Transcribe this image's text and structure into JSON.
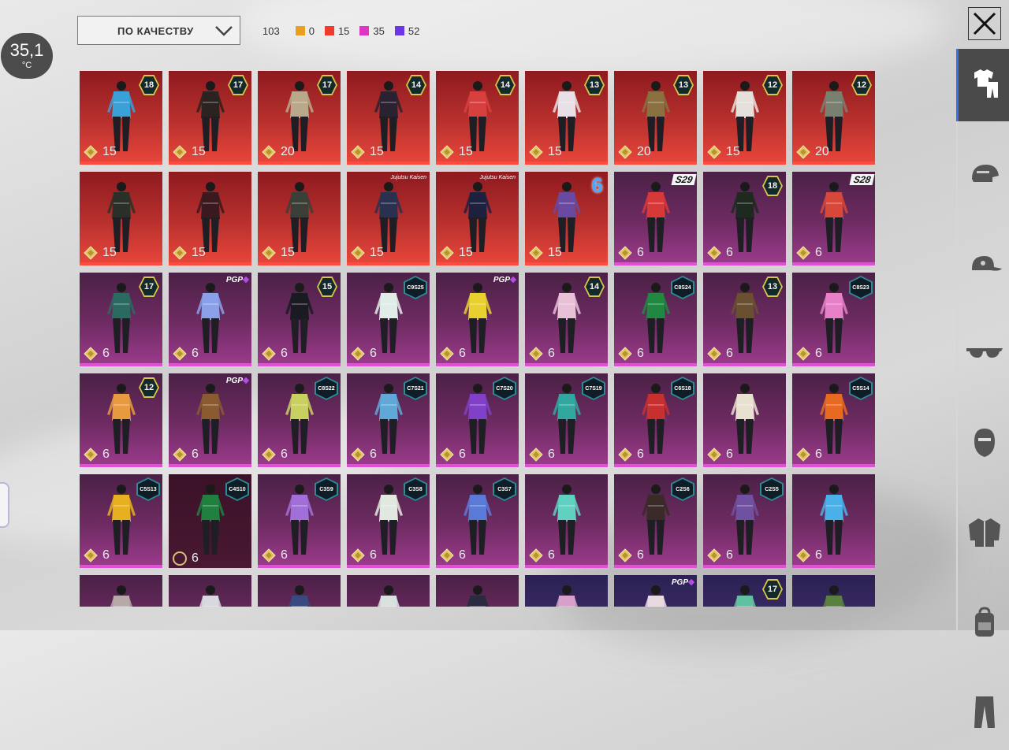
{
  "status": {
    "temperature": "35,1",
    "unit": "°C"
  },
  "sort": {
    "label": "ПО КАЧЕСТВУ"
  },
  "stats": {
    "total": "103",
    "items": [
      {
        "name": "gold",
        "value": "0",
        "color": "#e8a020"
      },
      {
        "name": "red",
        "value": "15",
        "color": "#f03a2e"
      },
      {
        "name": "pink",
        "value": "35",
        "color": "#e034c4"
      },
      {
        "name": "purple",
        "value": "52",
        "color": "#6a36e8"
      }
    ]
  },
  "categories": [
    {
      "id": "outfits",
      "icon": "shirt-pants-icon",
      "active": true
    },
    {
      "id": "helmets",
      "icon": "helmet-icon"
    },
    {
      "id": "hats",
      "icon": "cap-icon"
    },
    {
      "id": "glasses",
      "icon": "sunglasses-icon"
    },
    {
      "id": "masks",
      "icon": "mask-icon"
    },
    {
      "id": "jackets",
      "icon": "jacket-icon"
    },
    {
      "id": "backpacks",
      "icon": "backpack-icon"
    },
    {
      "id": "pants",
      "icon": "pants-icon"
    }
  ],
  "rows": [
    [
      {
        "tier": "red",
        "badge": "lvl",
        "badge_text": "18",
        "points": "15",
        "outfit": "#3aa0d8"
      },
      {
        "tier": "red",
        "badge": "lvl",
        "badge_text": "17",
        "points": "15",
        "outfit": "#2a2320"
      },
      {
        "tier": "red",
        "badge": "lvl",
        "badge_text": "17",
        "points": "20",
        "outfit": "#b9a98a"
      },
      {
        "tier": "red",
        "badge": "lvl",
        "badge_text": "14",
        "points": "15",
        "outfit": "#2a2230"
      },
      {
        "tier": "red",
        "badge": "lvl",
        "badge_text": "14",
        "points": "15",
        "outfit": "#d84040"
      },
      {
        "tier": "red",
        "badge": "lvl",
        "badge_text": "13",
        "points": "15",
        "outfit": "#e8e0e6"
      },
      {
        "tier": "red",
        "badge": "lvl",
        "badge_text": "13",
        "points": "20",
        "outfit": "#8a7040"
      },
      {
        "tier": "red",
        "badge": "lvl",
        "badge_text": "12",
        "points": "15",
        "outfit": "#e6e0dc"
      },
      {
        "tier": "red",
        "badge": "lvl",
        "badge_text": "12",
        "points": "20",
        "outfit": "#7a8070"
      }
    ],
    [
      {
        "tier": "red",
        "badge": "none",
        "badge_text": "",
        "points": "15",
        "outfit": "#2a3028"
      },
      {
        "tier": "red",
        "badge": "none",
        "badge_text": "",
        "points": "15",
        "outfit": "#3a1a1e"
      },
      {
        "tier": "red",
        "badge": "none",
        "badge_text": "",
        "points": "15",
        "outfit": "#3a4038"
      },
      {
        "tier": "red",
        "badge": "tag",
        "badge_text": "Jujutsu Kaisen",
        "points": "15",
        "outfit": "#2a3050"
      },
      {
        "tier": "red",
        "badge": "tag",
        "badge_text": "Jujutsu Kaisen",
        "points": "15",
        "outfit": "#1e2040"
      },
      {
        "tier": "red",
        "badge": "big",
        "badge_text": "6",
        "points": "15",
        "outfit": "#6a4aa0"
      },
      {
        "tier": "pink",
        "badge": "season",
        "badge_text": "S29",
        "points": "6",
        "outfit": "#d83838"
      },
      {
        "tier": "pink",
        "badge": "lvl",
        "badge_text": "18",
        "points": "6",
        "outfit": "#1e2a20"
      },
      {
        "tier": "pink",
        "badge": "season",
        "badge_text": "S28",
        "points": "6",
        "outfit": "#d8483a"
      }
    ],
    [
      {
        "tier": "pink",
        "badge": "lvl",
        "badge_text": "17",
        "points": "6",
        "outfit": "#2a6a60"
      },
      {
        "tier": "pink",
        "badge": "ppl",
        "badge_text": "PGP",
        "points": "6",
        "outfit": "#8aa0e8"
      },
      {
        "tier": "pink",
        "badge": "lvl",
        "badge_text": "15",
        "points": "6",
        "outfit": "#1a1a22"
      },
      {
        "tier": "pink",
        "badge": "hex",
        "badge_text": "C9S25",
        "points": "6",
        "outfit": "#e0ece8"
      },
      {
        "tier": "pink",
        "badge": "ppl",
        "badge_text": "PGP",
        "points": "6",
        "outfit": "#e8d030"
      },
      {
        "tier": "pink",
        "badge": "lvl",
        "badge_text": "14",
        "points": "6",
        "outfit": "#e8c0d8"
      },
      {
        "tier": "pink",
        "badge": "hex",
        "badge_text": "C8S24",
        "points": "6",
        "outfit": "#208840"
      },
      {
        "tier": "pink",
        "badge": "lvl",
        "badge_text": "13",
        "points": "6",
        "outfit": "#6a5030"
      },
      {
        "tier": "pink",
        "badge": "hex",
        "badge_text": "C8S23",
        "points": "6",
        "outfit": "#e880c8"
      }
    ],
    [
      {
        "tier": "pink",
        "badge": "lvl",
        "badge_text": "12",
        "points": "6",
        "outfit": "#e89a40"
      },
      {
        "tier": "pink",
        "badge": "ppl",
        "badge_text": "PGP",
        "points": "6",
        "outfit": "#8a5a30"
      },
      {
        "tier": "pink",
        "badge": "hex",
        "badge_text": "C8S22",
        "points": "6",
        "outfit": "#c8d060"
      },
      {
        "tier": "pink",
        "badge": "hex",
        "badge_text": "C7S21",
        "points": "6",
        "outfit": "#60a8d8"
      },
      {
        "tier": "pink",
        "badge": "hex",
        "badge_text": "C7S20",
        "points": "6",
        "outfit": "#8040c8"
      },
      {
        "tier": "pink",
        "badge": "hex",
        "badge_text": "C7S19",
        "points": "6",
        "outfit": "#30a8a0"
      },
      {
        "tier": "pink",
        "badge": "hex",
        "badge_text": "C6S18",
        "points": "6",
        "outfit": "#c83030"
      },
      {
        "tier": "pink",
        "badge": "none",
        "badge_text": "",
        "points": "6",
        "outfit": "#e8e0d0"
      },
      {
        "tier": "pink",
        "badge": "hex",
        "badge_text": "C5S14",
        "points": "6",
        "outfit": "#e86a20"
      }
    ],
    [
      {
        "tier": "pink",
        "badge": "hex",
        "badge_text": "C5S13",
        "points": "6",
        "outfit": "#e8b020"
      },
      {
        "tier": "dark",
        "badge": "hex",
        "badge_text": "C4S10",
        "points": "6",
        "outfit": "#208040",
        "gem": "ring"
      },
      {
        "tier": "pink",
        "badge": "hex",
        "badge_text": "C3S9",
        "points": "6",
        "outfit": "#a070d8"
      },
      {
        "tier": "pink",
        "badge": "hex",
        "badge_text": "C3S8",
        "points": "6",
        "outfit": "#e0e8e0"
      },
      {
        "tier": "pink",
        "badge": "hex",
        "badge_text": "C3S7",
        "points": "6",
        "outfit": "#5a7ad8"
      },
      {
        "tier": "pink",
        "badge": "none",
        "badge_text": "",
        "points": "6",
        "outfit": "#60d0c0"
      },
      {
        "tier": "pink",
        "badge": "hex",
        "badge_text": "C2S6",
        "points": "6",
        "outfit": "#3a2a28"
      },
      {
        "tier": "pink",
        "badge": "hex",
        "badge_text": "C2S5",
        "points": "6",
        "outfit": "#7050a0"
      },
      {
        "tier": "pink",
        "badge": "none",
        "badge_text": "",
        "points": "6",
        "outfit": "#4ab0e8"
      }
    ],
    [
      {
        "tier": "pink",
        "badge": "none",
        "badge_text": "",
        "points": "",
        "outfit": "#b8a8a8"
      },
      {
        "tier": "pink",
        "badge": "none",
        "badge_text": "",
        "points": "",
        "outfit": "#d8d8e0"
      },
      {
        "tier": "pink",
        "badge": "none",
        "badge_text": "",
        "points": "",
        "outfit": "#3a4a80"
      },
      {
        "tier": "pink",
        "badge": "none",
        "badge_text": "",
        "points": "",
        "outfit": "#d8e0e0"
      },
      {
        "tier": "pink",
        "badge": "none",
        "badge_text": "",
        "points": "",
        "outfit": "#2a2a40"
      },
      {
        "tier": "purple",
        "badge": "none",
        "badge_text": "",
        "points": "",
        "outfit": "#d8a0c8"
      },
      {
        "tier": "purple",
        "badge": "ppl",
        "badge_text": "PGP",
        "points": "",
        "outfit": "#e8d8e0"
      },
      {
        "tier": "purple",
        "badge": "lvl",
        "badge_text": "17",
        "points": "",
        "outfit": "#60c0a0"
      },
      {
        "tier": "purple",
        "badge": "none",
        "badge_text": "",
        "points": "",
        "outfit": "#5a8040"
      }
    ]
  ]
}
